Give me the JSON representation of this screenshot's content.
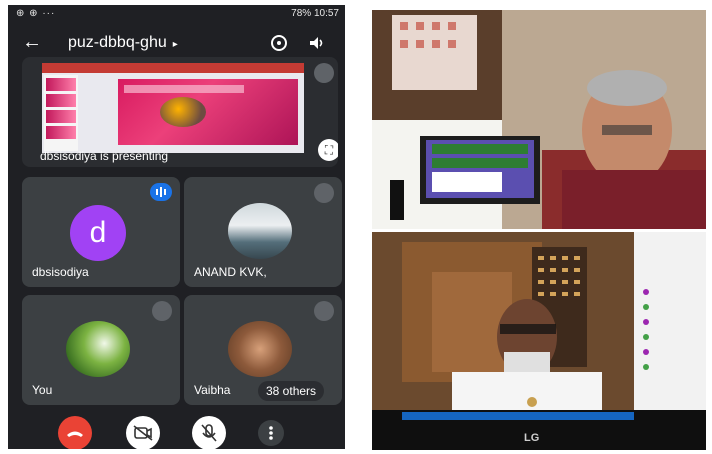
{
  "statusbar": {
    "left_icons": "⊕ ⊕ ···",
    "right": "78% 10:57"
  },
  "meeting": {
    "code": "puz-dbbq-ghu",
    "presenting_label": "dbsisodiya is presenting",
    "participants": [
      {
        "name": "dbsisodiya",
        "initial": "d"
      },
      {
        "name": "ANAND KVK,"
      },
      {
        "name": "You"
      },
      {
        "name": "Vaibha"
      }
    ],
    "others_label": "38 others"
  },
  "monitor_brand": "LG",
  "colors": {
    "phone_bg": "#1f2024",
    "tile_bg": "#3c4043",
    "end_call": "#ea4335",
    "avatar_purple": "#a142f4",
    "speaking_blue": "#1a73e8"
  },
  "icons": {
    "back": "arrow-left",
    "switch_camera": "camera-switch",
    "speaker": "volume",
    "fullscreen": "fullscreen",
    "mic_off": "mic-off",
    "end_call": "phone-end",
    "camera_off": "video-off",
    "more": "more-vertical"
  }
}
